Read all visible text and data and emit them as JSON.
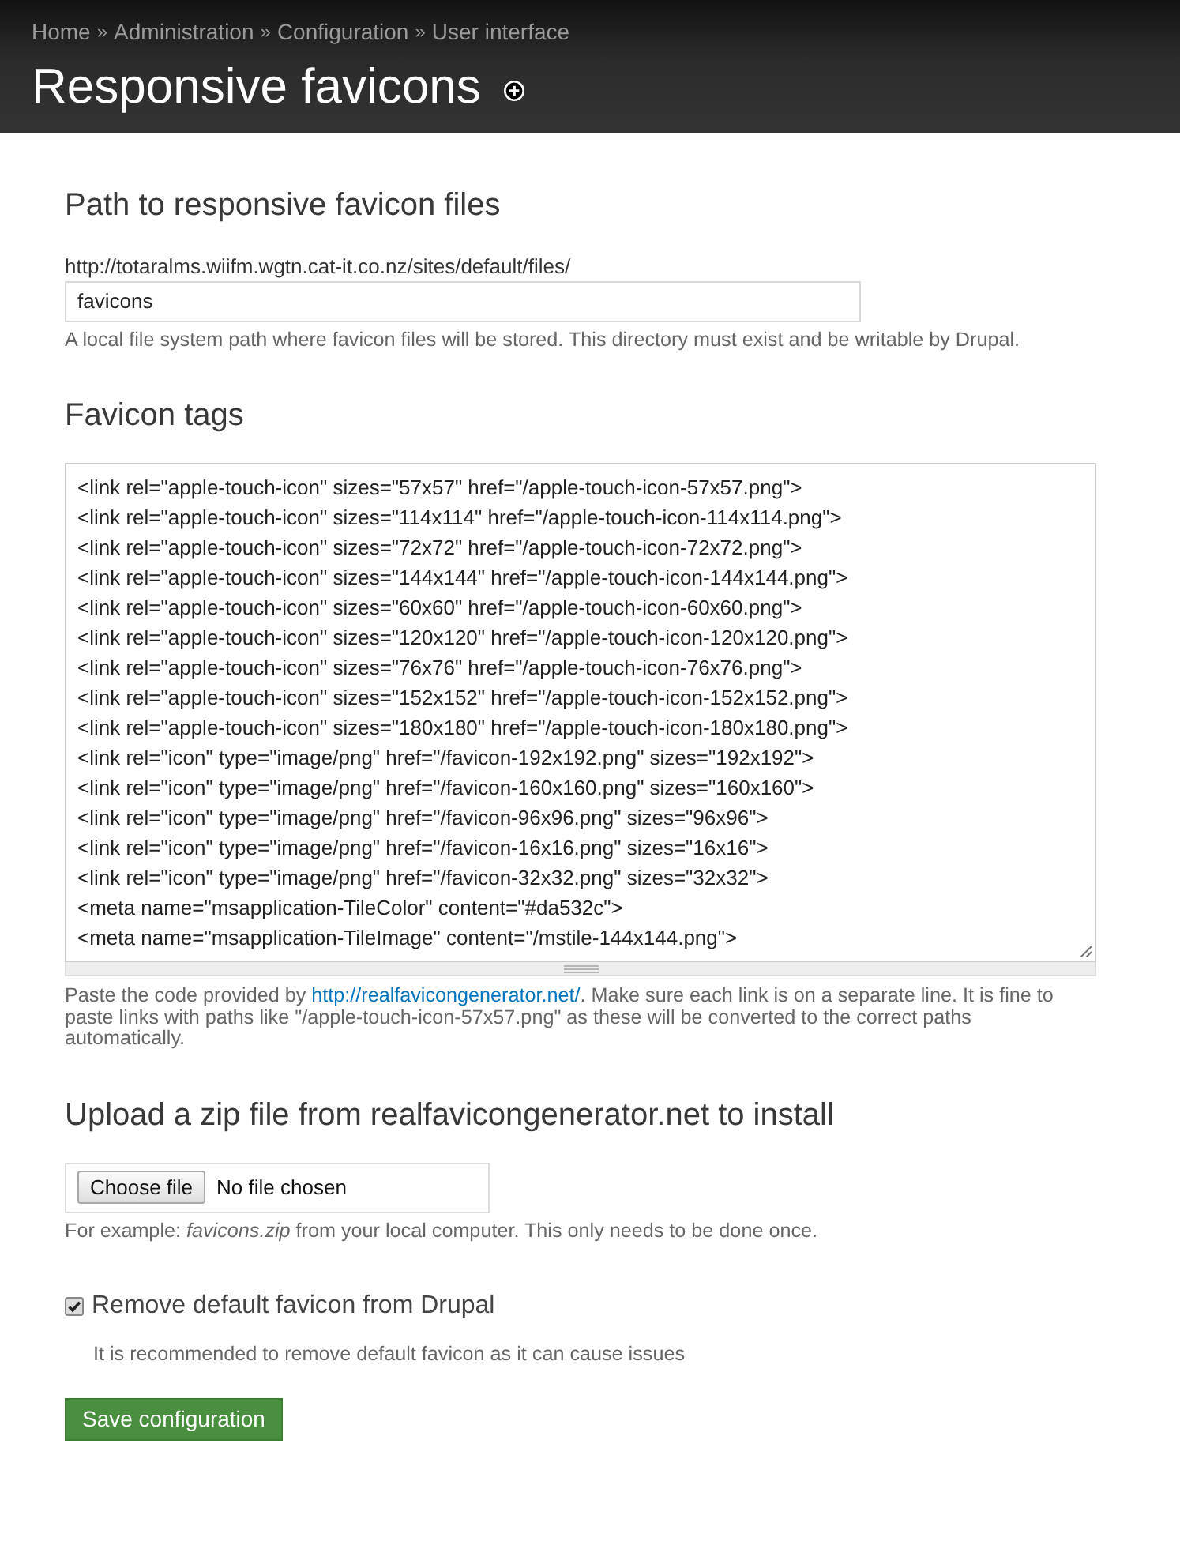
{
  "breadcrumb": [
    {
      "kind": "link",
      "text": "Home"
    },
    {
      "kind": "separator",
      "text": "»"
    },
    {
      "kind": "link",
      "text": "Administration"
    },
    {
      "kind": "separator",
      "text": "»"
    },
    {
      "kind": "link",
      "text": "Configuration"
    },
    {
      "kind": "separator",
      "text": "»"
    },
    {
      "kind": "link",
      "text": "User interface"
    }
  ],
  "title": "Responsive favicons",
  "path_section": {
    "heading": "Path to responsive favicon files",
    "prefix": "http://totaralms.wiifm.wgtn.cat-it.co.nz/sites/default/files/",
    "field": {
      "value": "favicons"
    },
    "description": "A local file system path where favicon files will be stored. This directory must exist and be writable by Drupal."
  },
  "tags_section": {
    "heading": "Favicon tags",
    "lines": [
      "<link rel=\"apple-touch-icon\" sizes=\"57x57\" href=\"/apple-touch-icon-57x57.png\">",
      "<link rel=\"apple-touch-icon\" sizes=\"114x114\" href=\"/apple-touch-icon-114x114.png\">",
      "<link rel=\"apple-touch-icon\" sizes=\"72x72\" href=\"/apple-touch-icon-72x72.png\">",
      "<link rel=\"apple-touch-icon\" sizes=\"144x144\" href=\"/apple-touch-icon-144x144.png\">",
      "<link rel=\"apple-touch-icon\" sizes=\"60x60\" href=\"/apple-touch-icon-60x60.png\">",
      "<link rel=\"apple-touch-icon\" sizes=\"120x120\" href=\"/apple-touch-icon-120x120.png\">",
      "<link rel=\"apple-touch-icon\" sizes=\"76x76\" href=\"/apple-touch-icon-76x76.png\">",
      "<link rel=\"apple-touch-icon\" sizes=\"152x152\" href=\"/apple-touch-icon-152x152.png\">",
      "<link rel=\"apple-touch-icon\" sizes=\"180x180\" href=\"/apple-touch-icon-180x180.png\">",
      "<link rel=\"icon\" type=\"image/png\" href=\"/favicon-192x192.png\" sizes=\"192x192\">",
      "<link rel=\"icon\" type=\"image/png\" href=\"/favicon-160x160.png\" sizes=\"160x160\">",
      "<link rel=\"icon\" type=\"image/png\" href=\"/favicon-96x96.png\" sizes=\"96x96\">",
      "<link rel=\"icon\" type=\"image/png\" href=\"/favicon-16x16.png\" sizes=\"16x16\">",
      "<link rel=\"icon\" type=\"image/png\" href=\"/favicon-32x32.png\" sizes=\"32x32\">",
      "<meta name=\"msapplication-TileColor\" content=\"#da532c\">",
      "<meta name=\"msapplication-TileImage\" content=\"/mstile-144x144.png\">"
    ],
    "description": [
      {
        "kind": "text",
        "text": "Paste the code provided by "
      },
      {
        "kind": "link",
        "text": "http://realfavicongenerator.net/"
      },
      {
        "kind": "text",
        "text": ". Make sure each link is on a separate line. It is fine to paste links with paths like \"/apple-touch-icon-57x57.png\" as these will be converted to the correct paths automatically."
      }
    ]
  },
  "upload_section": {
    "heading": "Upload a zip file from realfavicongenerator.net to install",
    "button": "Choose file",
    "status": "No file chosen",
    "description": "For example: *favicons.zip* from your local computer. This only needs to be done once."
  },
  "remove_default": {
    "label": "Remove default favicon from Drupal",
    "checked": true,
    "description": "It is recommended to remove default favicon as it can cause issues"
  },
  "save_button": "Save configuration"
}
